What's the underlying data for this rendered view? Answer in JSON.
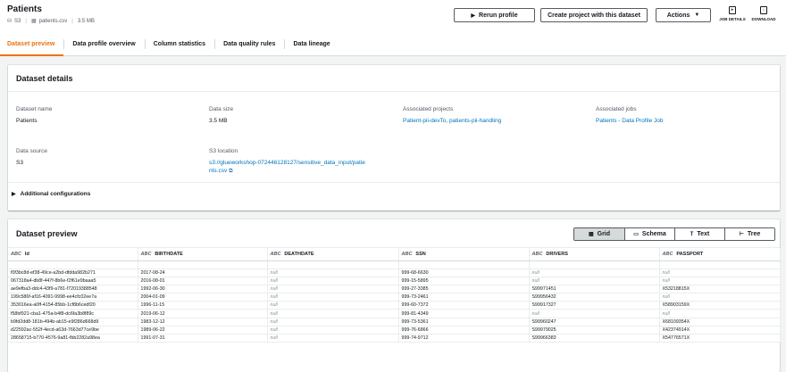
{
  "header": {
    "title": "Patients",
    "source_type": "S3",
    "file_name": "patients.csv",
    "file_size": "3.5 MB",
    "rerun_label": "Rerun profile",
    "create_project_label": "Create project with this dataset",
    "actions_label": "Actions",
    "job_details_label": "JOB DETAILS",
    "download_label": "DOWNLOAD"
  },
  "tabs": [
    {
      "label": "Dataset preview"
    },
    {
      "label": "Data profile overview"
    },
    {
      "label": "Column statistics"
    },
    {
      "label": "Data quality rules"
    },
    {
      "label": "Data lineage"
    }
  ],
  "details": {
    "heading": "Dataset details",
    "dataset_name_label": "Dataset name",
    "dataset_name": "Patients",
    "data_size_label": "Data size",
    "data_size": "3.5 MB",
    "assoc_projects_label": "Associated projects",
    "assoc_projects": "Patient-pii-devTo, patients-pii-handling",
    "assoc_jobs_label": "Associated jobs",
    "assoc_jobs": "Patients - Data Profile Job",
    "data_source_label": "Data source",
    "data_source": "S3",
    "s3_location_label": "S3 location",
    "s3_location_line1": "s3://glueworkshop-072446128127/sensitive_data_input/patie",
    "s3_location_line2": "nts.csv",
    "additional_label": "Additional configurations"
  },
  "preview": {
    "heading": "Dataset preview",
    "views": [
      {
        "label": "Grid",
        "icon": "grid-icon"
      },
      {
        "label": "Schema",
        "icon": "schema-icon"
      },
      {
        "label": "Text",
        "icon": "text-icon"
      },
      {
        "label": "Tree",
        "icon": "tree-icon"
      }
    ],
    "type_tag": "ABC",
    "columns": [
      "Id",
      "BIRTHDATE",
      "DEATHDATE",
      "SSN",
      "DRIVERS",
      "PASSPORT"
    ],
    "rows": [
      [
        "f0f3bc8d-ef38-49ce-a2bd-dfdda982b271",
        "2017-08-24",
        "null",
        "999-68-6630",
        "null",
        "null"
      ],
      [
        "067318a4-db8f-447f-8b6e-f2f61e9baaa5",
        "2016-08-01",
        "null",
        "999-15-5895",
        "null",
        "null"
      ],
      [
        "ae9efba3-ddc4-43f9-a781-f72019388548",
        "1992-06-30",
        "null",
        "999-27-3385",
        "S99971451",
        "X53218815X"
      ],
      [
        "199c586f-af16-4091-9998-ee4cfc02ee7a",
        "2004-01-09",
        "null",
        "999-73-2461",
        "S99956432",
        "null"
      ],
      [
        "353016ea-a0ff-4154-85bb-1cf8b6cedf20",
        "1996-11-15",
        "null",
        "999-60-7372",
        "S99917327",
        "X58903159X"
      ],
      [
        "f58bf921-cba1-475a-b4f8-dc6fa3b8f89c",
        "2019-06-12",
        "null",
        "999-81-4349",
        "null",
        "null"
      ],
      [
        "b9fd2dd8-181b-494b-ab15-e9f286d668d9",
        "1983-12-12",
        "null",
        "999-73-5361",
        "S99960247",
        "X68109354X"
      ],
      [
        "d22592ac-552f-4ecd-a63d-7663d77ce9be",
        "1989-06-22",
        "null",
        "999-76-6866",
        "S99979025",
        "X42374914X"
      ],
      [
        "28658715-b770-4576-9a81-fbb2282a98ea",
        "1991-07-31",
        "null",
        "999-74-9712",
        "S99966383",
        "X54776571X"
      ]
    ]
  }
}
